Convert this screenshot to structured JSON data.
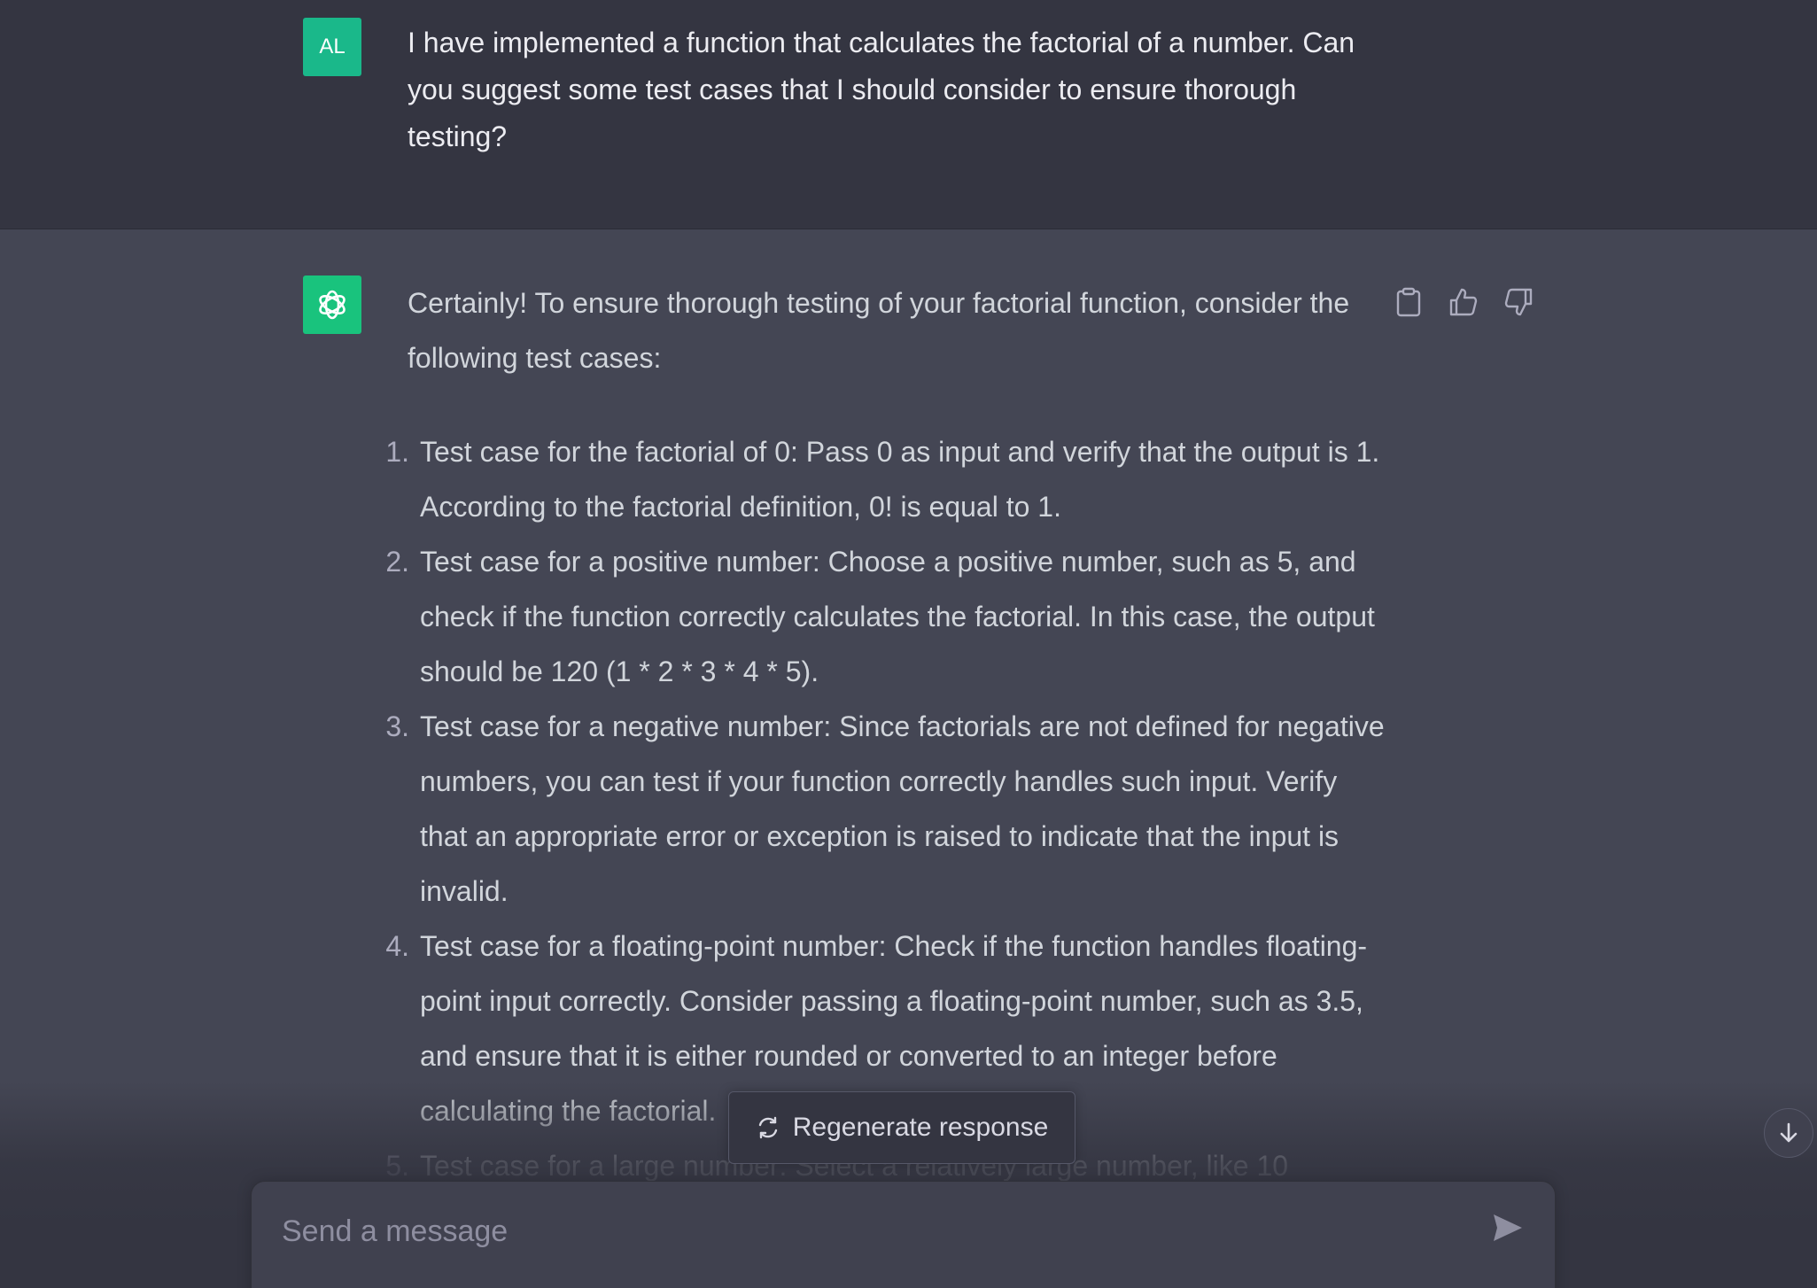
{
  "user_message": {
    "avatar_initials": "AL",
    "text": "I have implemented a function that calculates the factorial of a number. Can you suggest some test cases that I should consider to ensure thorough testing?"
  },
  "assistant_message": {
    "avatar_icon": "openai-logo-icon",
    "intro": "Certainly! To ensure thorough testing of your factorial function, consider the following test cases:",
    "items": [
      {
        "number": "1.",
        "text": "Test case for the factorial of 0: Pass 0 as input and verify that the output is 1. According to the factorial definition, 0! is equal to 1."
      },
      {
        "number": "2.",
        "text": "Test case for a positive number: Choose a positive number, such as 5, and check if the function correctly calculates the factorial. In this case, the output should be 120 (1 * 2 * 3 * 4 * 5)."
      },
      {
        "number": "3.",
        "text": "Test case for a negative number: Since factorials are not defined for negative numbers, you can test if your function correctly handles such input. Verify that an appropriate error or exception is raised to indicate that the input is invalid."
      },
      {
        "number": "4.",
        "text": "Test case for a floating-point number: Check if the function handles floating-point input correctly. Consider passing a floating-point number, such as 3.5, and ensure that it is either rounded or converted to an integer before calculating the factorial."
      },
      {
        "number": "5.",
        "text": "Test case for a large number: Select a relatively large number, like 10"
      }
    ],
    "actions": [
      "clipboard-icon",
      "thumbs-up-icon",
      "thumbs-down-icon"
    ]
  },
  "regenerate": {
    "label": "Regenerate response",
    "icon": "refresh-icon"
  },
  "scroll_button": {
    "icon": "arrow-down-icon"
  },
  "composer": {
    "placeholder": "Send a message",
    "value": "",
    "send_icon": "send-icon"
  },
  "colors": {
    "user_bg": "#343541",
    "assistant_bg": "#444654",
    "accent_green": "#19c37d",
    "text_primary": "#ececf1",
    "text_secondary": "#d1d5db"
  }
}
